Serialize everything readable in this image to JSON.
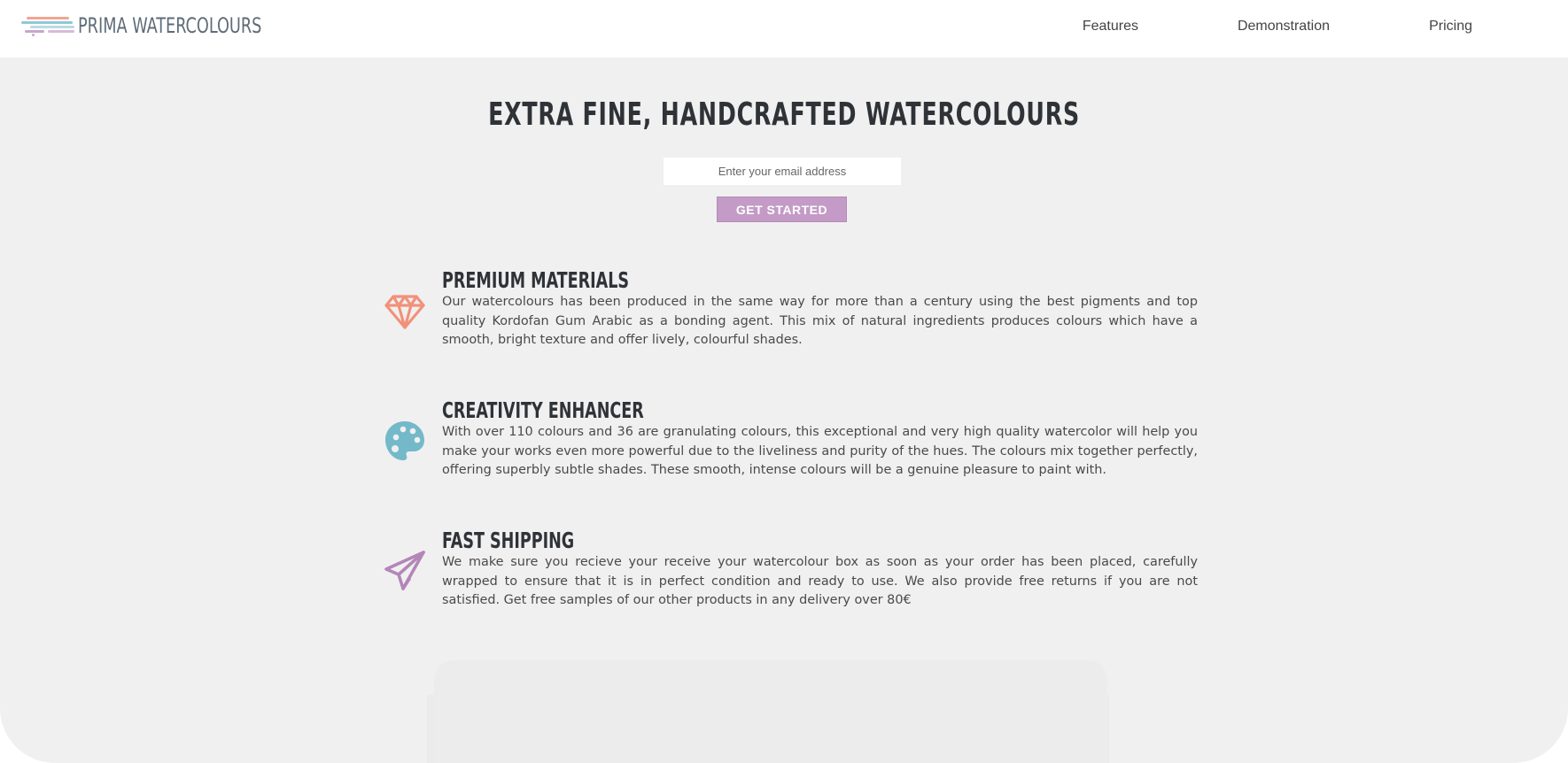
{
  "header": {
    "logo_text": "PRIMA WATERCOLOURS",
    "nav": [
      {
        "label": "Features"
      },
      {
        "label": "Demonstration"
      },
      {
        "label": "Pricing"
      }
    ]
  },
  "hero": {
    "title": "EXTRA FINE, HANDCRAFTED WATERCOLOURS",
    "email_placeholder": "Enter your email address",
    "cta_label": "GET STARTED"
  },
  "features": [
    {
      "icon": "diamond-icon",
      "title": "PREMIUM MATERIALS",
      "text": "Our watercolours has been produced in the same way for more than a century using the best pigments and top quality Kordofan Gum Arabic as a bonding agent. This mix of natural ingredients produces colours which have a smooth, bright texture and offer lively, colourful shades."
    },
    {
      "icon": "palette-icon",
      "title": "CREATIVITY ENHANCER",
      "text": "With over 110 colours and 36 are granulating colours, this exceptional and very high quality watercolor will help you make your works even more powerful due to the liveliness and purity of the hues. The colours mix together perfectly, offering superbly subtle shades. These smooth, intense colours will be a genuine pleasure to paint with."
    },
    {
      "icon": "paper-plane-icon",
      "title": "FAST SHIPPING",
      "text": "We make sure you recieve your receive your watercolour box as soon as your order has been placed, carefully wrapped to ensure that it is in perfect condition and ready to use. We also provide free returns if you are not satisfied. Get free samples of our other products in any delivery over 80€"
    }
  ],
  "colors": {
    "background": "#f0f0f0",
    "header": "#ffffff",
    "accent_button": "#c39bc6",
    "diamond": "#f2917a",
    "palette": "#74b9c9",
    "plane": "#b386b8",
    "heading": "#2f3237",
    "body_text": "#4a4a4a"
  }
}
